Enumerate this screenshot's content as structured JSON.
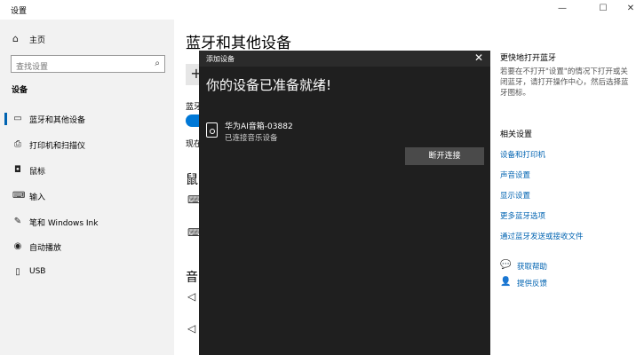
{
  "window": {
    "title": "设置",
    "minimize": "—",
    "maximize": "☐",
    "close": "✕"
  },
  "sidebar": {
    "home": "主页",
    "search_placeholder": "查找设置",
    "section": "设备",
    "items": [
      {
        "label": "蓝牙和其他设备",
        "icon": "bluetooth-icon"
      },
      {
        "label": "打印机和扫描仪",
        "icon": "printer-icon"
      },
      {
        "label": "鼠标",
        "icon": "mouse-icon"
      },
      {
        "label": "输入",
        "icon": "keyboard-icon"
      },
      {
        "label": "笔和 Windows Ink",
        "icon": "pen-icon"
      },
      {
        "label": "自动播放",
        "icon": "autoplay-icon"
      },
      {
        "label": "USB",
        "icon": "usb-icon"
      }
    ]
  },
  "main": {
    "title": "蓝牙和其他设备",
    "add_button": "+",
    "bluetooth_label": "蓝牙",
    "now_text": "现在",
    "mouse_heading": "鼠",
    "audio_heading": "音"
  },
  "right": {
    "heading": "更快地打开蓝牙",
    "desc": "若要在不打开\"设置\"的情况下打开或关闭蓝牙，请打开操作中心，然后选择蓝牙图标。",
    "related_heading": "相关设置",
    "links": [
      "设备和打印机",
      "声音设置",
      "显示设置",
      "更多蓝牙选项",
      "通过蓝牙发送或接收文件"
    ],
    "help": "获取帮助",
    "feedback": "提供反馈"
  },
  "dialog": {
    "title": "添加设备",
    "heading": "你的设备已准备就绪!",
    "device_name": "华为AI音箱-03882",
    "device_status": "已连接音乐设备",
    "disconnect": "断开连接"
  },
  "colors": {
    "accent": "#0078d7",
    "link": "#0063b1",
    "dialog_bg": "#1f1f1f",
    "sidebar_bg": "#f2f2f2"
  }
}
